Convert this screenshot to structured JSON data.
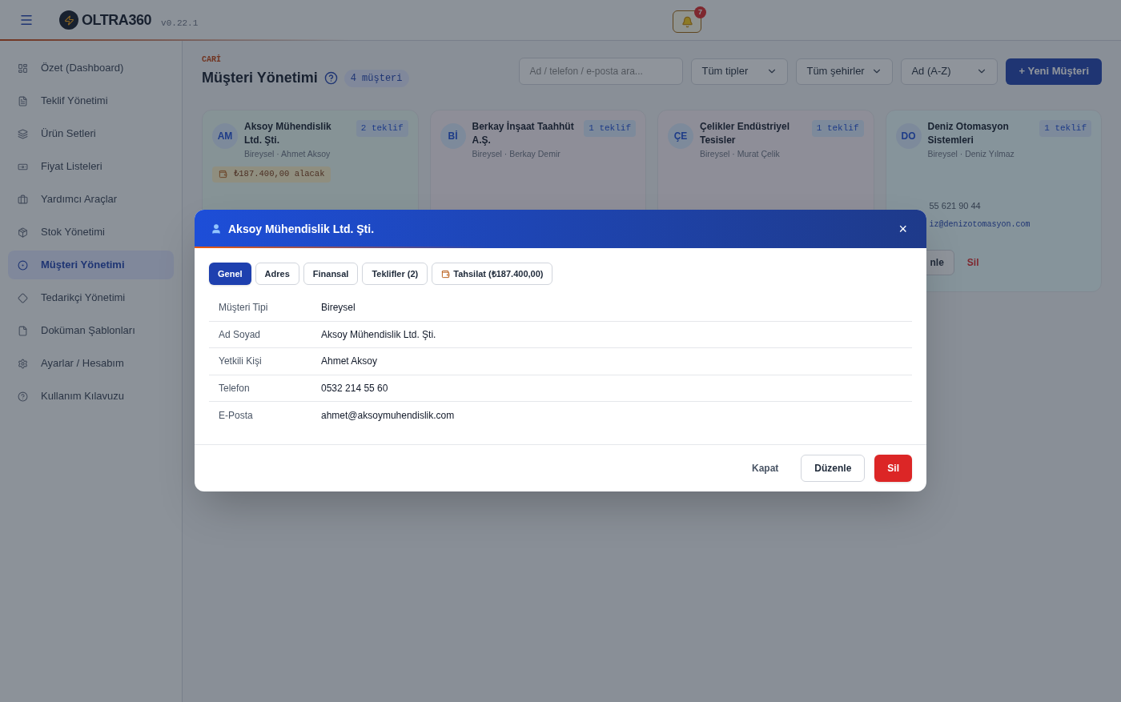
{
  "topbar": {
    "logo": "OLTRA360",
    "version": "v0.22.1",
    "notifications": "7"
  },
  "sidebar": {
    "items": [
      {
        "label": "Özet (Dashboard)",
        "selected": false
      },
      {
        "label": "Teklif Yönetimi",
        "selected": false
      },
      {
        "label": "Ürün Setleri",
        "selected": false
      },
      {
        "label": "Fiyat Listeleri",
        "selected": false
      },
      {
        "label": "Yardımcı Araçlar",
        "selected": false
      },
      {
        "label": "Stok Yönetimi",
        "selected": false
      },
      {
        "label": "Müşteri Yönetimi",
        "selected": true
      },
      {
        "label": "Tedarikçi Yönetimi",
        "selected": false
      },
      {
        "label": "Doküman Şablonları",
        "selected": false
      },
      {
        "label": "Ayarlar / Hesabım",
        "selected": false
      },
      {
        "label": "Kullanım Kılavuzu",
        "selected": false
      }
    ]
  },
  "page": {
    "eyebrow": "CARİ",
    "title": "Müşteri Yönetimi",
    "count": "4 müşteri",
    "search_placeholder": "Ad / telefon / e-posta ara...",
    "filters": [
      "Tüm tipler",
      "Tüm şehirler",
      "Ad (A-Z)"
    ],
    "new_button": "+ Yeni Müşteri"
  },
  "cards": [
    {
      "initials": "AM",
      "name": "Aksoy Mühendislik Ltd. Şti.",
      "offers": "2 teklif",
      "subtitle": "Bireysel · Ahmet Aksoy",
      "balance": "₺187.400,00 alacak"
    },
    {
      "initials": "Bİ",
      "name": "Berkay İnşaat Taahhüt A.Ş.",
      "offers": "1 teklif",
      "subtitle": "Bireysel · Berkay Demir"
    },
    {
      "initials": "ÇE",
      "name": "Çelikler Endüstriyel Tesisler",
      "offers": "1 teklif",
      "subtitle": "Bireysel · Murat Çelik"
    },
    {
      "initials": "DO",
      "name": "Deniz Otomasyon Sistemleri",
      "offers": "1 teklif",
      "subtitle": "Bireysel · Deniz Yılmaz",
      "phone": "55 621 90 44",
      "email": "iz@denizotomasyon.com",
      "edit": "nle",
      "delete": "Sil"
    }
  ],
  "modal": {
    "title": "Aksoy Mühendislik Ltd. Şti.",
    "close": "×",
    "tabs": [
      {
        "label": "Genel",
        "selected": true
      },
      {
        "label": "Adres",
        "selected": false
      },
      {
        "label": "Finansal",
        "selected": false
      },
      {
        "label": "Teklifler (2)",
        "selected": false
      },
      {
        "label": "Tahsilat (₺187.400,00)",
        "selected": false,
        "kind": "payment"
      }
    ],
    "fields": [
      {
        "label": "Müşteri Tipi",
        "value": "Bireysel"
      },
      {
        "label": "Ad Soyad",
        "value": "Aksoy Mühendislik Ltd. Şti."
      },
      {
        "label": "Yetkili Kişi",
        "value": "Ahmet Aksoy"
      },
      {
        "label": "Telefon",
        "value": "0532 214 55 60"
      },
      {
        "label": "E-Posta",
        "value": "ahmet@aksoymuhendislik.com"
      }
    ],
    "buttons": {
      "close": "Kapat",
      "edit": "Düzenle",
      "delete": "Sil"
    }
  }
}
